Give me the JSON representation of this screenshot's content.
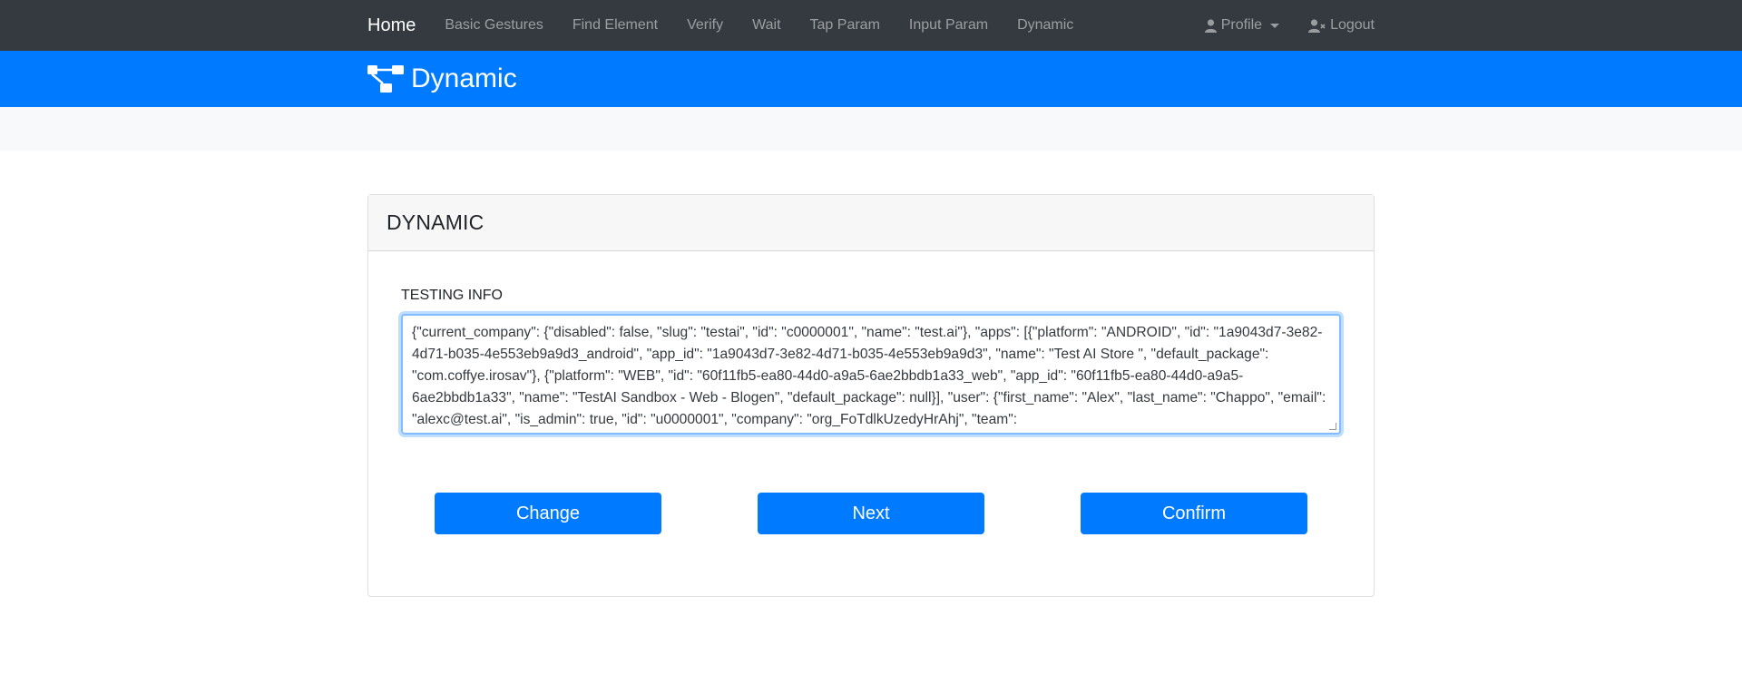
{
  "nav": {
    "brand": "Home",
    "links": [
      "Basic Gestures",
      "Find Element",
      "Verify",
      "Wait",
      "Tap Param",
      "Input Param",
      "Dynamic"
    ],
    "profile": "Profile",
    "logout": "Logout"
  },
  "hero": {
    "title": "Dynamic",
    "icon": "sitemap-icon"
  },
  "card": {
    "header": "DYNAMIC",
    "field_label": "TESTING INFO",
    "testing_info": "{\"current_company\": {\"disabled\": false, \"slug\": \"testai\", \"id\": \"c0000001\", \"name\": \"test.ai\"}, \"apps\": [{\"platform\": \"ANDROID\", \"id\": \"1a9043d7-3e82-4d71-b035-4e553eb9a9d3_android\", \"app_id\": \"1a9043d7-3e82-4d71-b035-4e553eb9a9d3\", \"name\": \"Test AI Store \", \"default_package\": \"com.coffye.irosav\"}, {\"platform\": \"WEB\", \"id\": \"60f11fb5-ea80-44d0-a9a5-6ae2bbdb1a33_web\", \"app_id\": \"60f11fb5-ea80-44d0-a9a5-6ae2bbdb1a33\", \"name\": \"TestAI Sandbox - Web - Blogen\", \"default_package\": null}], \"user\": {\"first_name\": \"Alex\", \"last_name\": \"Chappo\", \"email\": \"alexc@test.ai\", \"is_admin\": true, \"id\": \"u0000001\", \"company\": \"org_FoTdlkUzedyHrAhj\", \"team\":"
  },
  "buttons": {
    "change": "Change",
    "next": "Next",
    "confirm": "Confirm"
  },
  "colors": {
    "nav_bg": "#343a40",
    "primary": "#007bff",
    "subbar": "#f8f9fa"
  }
}
